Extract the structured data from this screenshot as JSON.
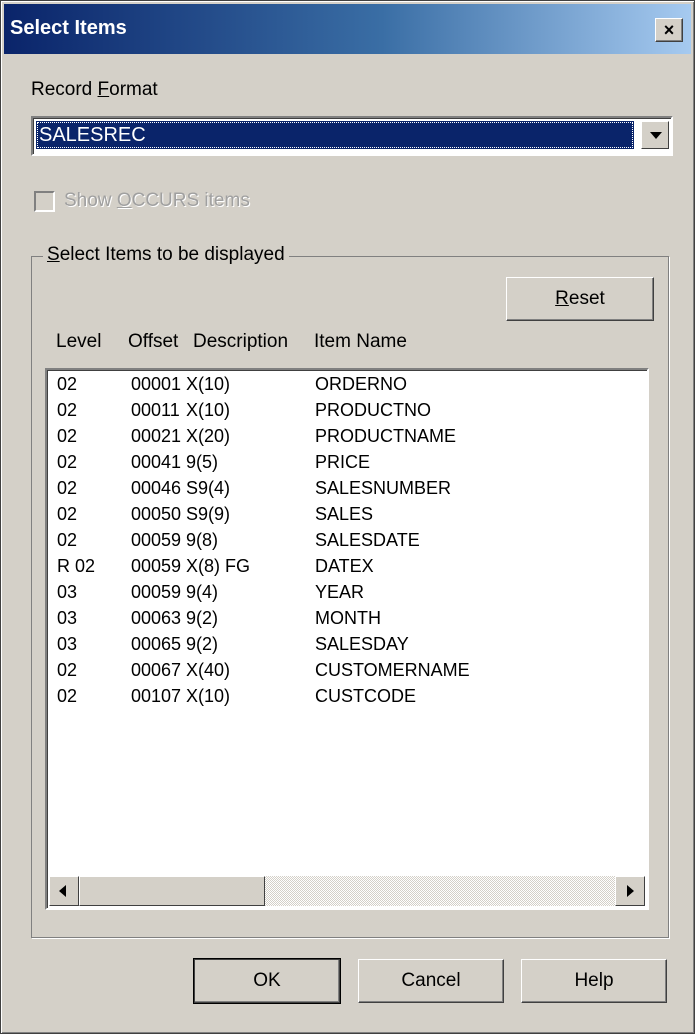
{
  "window": {
    "title": "Select Items",
    "close_glyph": "×"
  },
  "record_format": {
    "label_before": "Record ",
    "label_key": "F",
    "label_after": "ormat",
    "value": "SALESREC"
  },
  "show_occurs": {
    "label_before": "Show ",
    "label_key": "O",
    "label_after": "CCURS items",
    "checked": false,
    "enabled": false
  },
  "group": {
    "label_key": "S",
    "label_after": "elect Items to be displayed"
  },
  "reset_button": {
    "label_key": "R",
    "label_after": "eset"
  },
  "columns": {
    "level": "Level",
    "offset": "Offset",
    "description": "Description",
    "item_name": "Item Name"
  },
  "items": [
    {
      "level": "02",
      "offset": "00001",
      "description": "X(10)",
      "name": "ORDERNO"
    },
    {
      "level": "02",
      "offset": "00011",
      "description": "X(10)",
      "name": "PRODUCTNO"
    },
    {
      "level": "02",
      "offset": "00021",
      "description": "X(20)",
      "name": "PRODUCTNAME"
    },
    {
      "level": "02",
      "offset": "00041",
      "description": "9(5)",
      "name": "PRICE"
    },
    {
      "level": "02",
      "offset": "00046",
      "description": "S9(4)",
      "name": "SALESNUMBER"
    },
    {
      "level": "02",
      "offset": "00050",
      "description": "S9(9)",
      "name": "SALES"
    },
    {
      "level": "02",
      "offset": "00059",
      "description": "9(8)",
      "name": "SALESDATE"
    },
    {
      "level": "R 02",
      "offset": "00059",
      "description": "X(8) FG",
      "name": "DATEX"
    },
    {
      "level": "03",
      "offset": "00059",
      "description": "9(4)",
      "name": "YEAR"
    },
    {
      "level": "03",
      "offset": "00063",
      "description": "9(2)",
      "name": "MONTH"
    },
    {
      "level": "03",
      "offset": "00065",
      "description": "9(2)",
      "name": "SALESDAY"
    },
    {
      "level": "02",
      "offset": "00067",
      "description": "X(40)",
      "name": "CUSTOMERNAME"
    },
    {
      "level": "02",
      "offset": "00107",
      "description": "X(10)",
      "name": "CUSTCODE"
    }
  ],
  "buttons": {
    "ok": "OK",
    "cancel": "Cancel",
    "help": "Help"
  }
}
